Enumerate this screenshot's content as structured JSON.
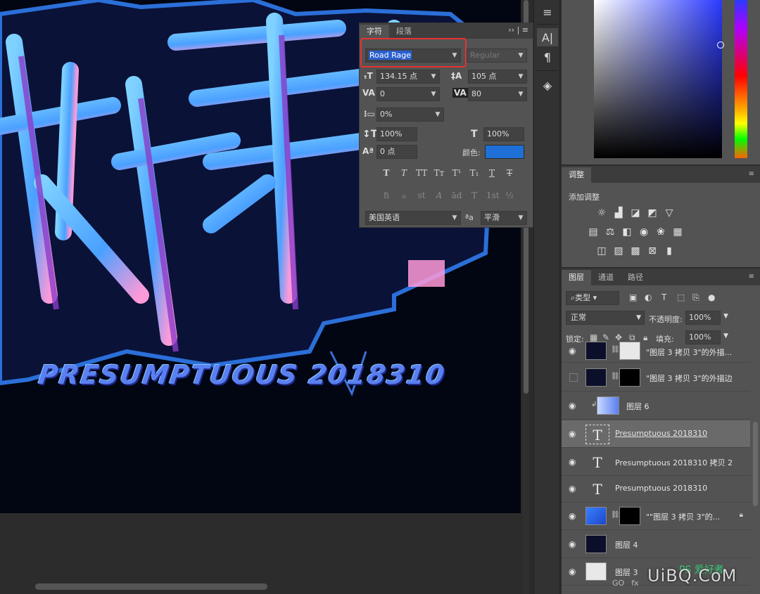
{
  "canvas": {
    "subtitle": "PRESUMPTUOUS 2018310"
  },
  "tool_strip": {
    "icons": [
      "adjust-sliders-icon",
      "character-panel-icon",
      "paragraph-icon",
      "3d-cube-icon"
    ],
    "char_label": "A|",
    "para_label": "¶"
  },
  "character_panel": {
    "tabs": [
      "字符",
      "段落"
    ],
    "font_family": "Road Rage",
    "font_style": "Regular",
    "font_size": "134.15 点",
    "leading": "105 点",
    "kerning": "0",
    "tracking": "80",
    "tsume": "0%",
    "vertical_scale": "100%",
    "horizontal_scale": "100%",
    "baseline_shift": "0 点",
    "color_label": "颜色:",
    "color_value": "#1e6fd6",
    "format_buttons_row1": [
      "T",
      "T",
      "TT",
      "Tт",
      "T¹",
      "T₁",
      "T",
      "T"
    ],
    "format_buttons_row2": [
      "fi",
      "ℴ",
      "st",
      "A",
      "ād",
      "T",
      "1st",
      "½"
    ],
    "language": "美国英语",
    "aa_label": "ªa",
    "antialias": "平滑"
  },
  "adjustments_panel": {
    "tab": "调整",
    "label": "添加调整"
  },
  "layers_panel": {
    "tabs": [
      "图层",
      "通道",
      "路径"
    ],
    "filter": "类型",
    "blend_mode": "正常",
    "opacity_label": "不透明度:",
    "opacity": "100%",
    "lock_label": "锁定:",
    "fill_label": "填充:",
    "fill": "100%",
    "layers": [
      {
        "name": "\"图层 3 拷贝 3\"的外描...",
        "visible": true
      },
      {
        "name": "\"图层 3 拷贝 3\"的外描边",
        "visible": false
      },
      {
        "name": "图层 6",
        "visible": true
      },
      {
        "name": "Presumptuous 2018310",
        "visible": true,
        "selected": true
      },
      {
        "name": "Presumptuous 2018310 拷贝 2",
        "visible": true
      },
      {
        "name": "Presumptuous 2018310",
        "visible": true
      },
      {
        "name": "\"\"图层 3 拷贝 3\"的...",
        "visible": true
      },
      {
        "name": "图层 4",
        "visible": true
      },
      {
        "name": "图层 3",
        "visible": true
      }
    ],
    "footer": [
      "GO",
      "fx"
    ]
  },
  "watermark": "UiBQ.CoM",
  "watermark_small": "PS 爱好者"
}
